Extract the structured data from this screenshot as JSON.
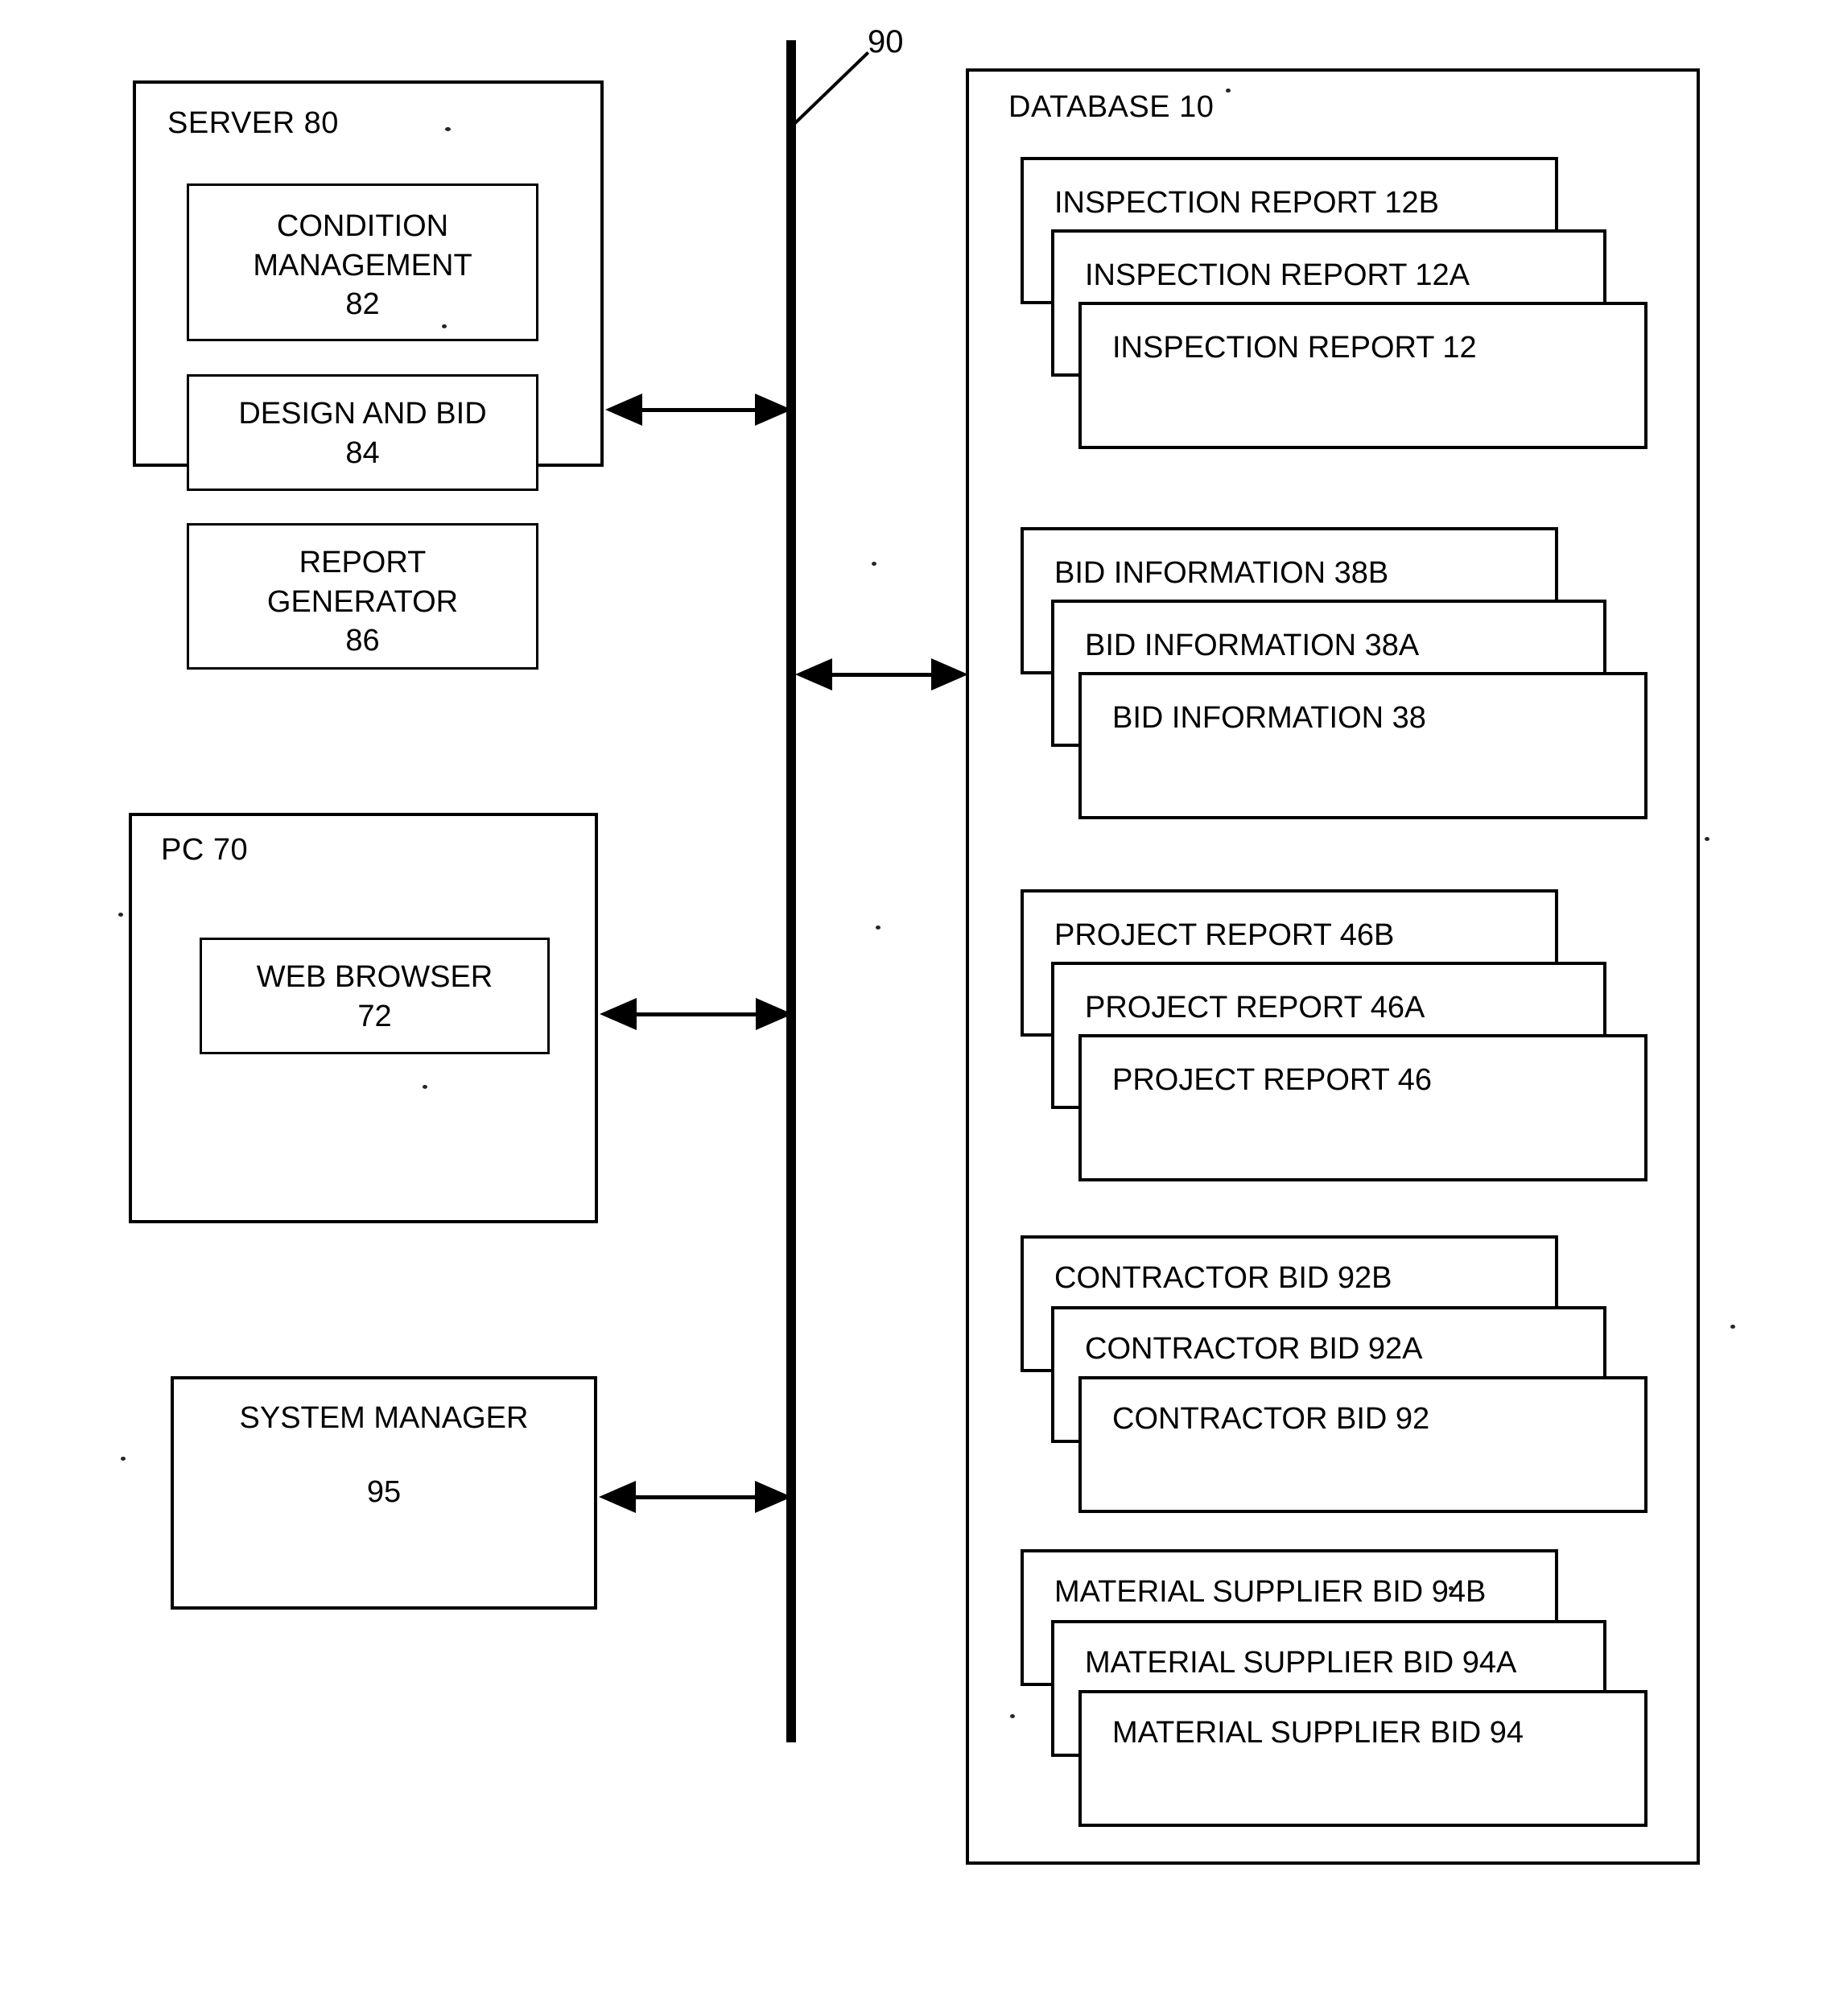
{
  "figure": {
    "network_bus_label": "90"
  },
  "server": {
    "title": "SERVER 80",
    "modules": [
      {
        "label": "CONDITION\nMANAGEMENT\n82"
      },
      {
        "label": "DESIGN AND BID\n84"
      },
      {
        "label": "REPORT\nGENERATOR\n86"
      }
    ]
  },
  "pc": {
    "title": "PC 70",
    "modules": [
      {
        "label": "WEB BROWSER\n72"
      }
    ]
  },
  "system_manager": {
    "title": "SYSTEM MANAGER",
    "number": "95"
  },
  "database": {
    "title": "DATABASE 10",
    "stacks": [
      {
        "name": "inspection-report-stack",
        "cards": [
          "INSPECTION REPORT  12B",
          "INSPECTION REPORT  12A",
          "INSPECTION REPORT 12"
        ]
      },
      {
        "name": "bid-information-stack",
        "cards": [
          "BID INFORMATION 38B",
          "BID INFORMATION 38A",
          "BID INFORMATION 38"
        ]
      },
      {
        "name": "project-report-stack",
        "cards": [
          "PROJECT REPORT 46B",
          "PROJECT REPORT 46A",
          "PROJECT REPORT 46"
        ]
      },
      {
        "name": "contractor-bid-stack",
        "cards": [
          "CONTRACTOR BID 92B",
          "CONTRACTOR BID 92A",
          "CONTRACTOR BID 92"
        ]
      },
      {
        "name": "material-supplier-bid-stack",
        "cards": [
          "MATERIAL SUPPLIER BID 94B",
          "MATERIAL SUPPLIER BID 94A",
          "MATERIAL SUPPLIER BID 94"
        ]
      }
    ]
  },
  "connections": [
    {
      "name": "server-to-network"
    },
    {
      "name": "network-to-database"
    },
    {
      "name": "pc-to-network"
    },
    {
      "name": "system-manager-to-network"
    }
  ]
}
